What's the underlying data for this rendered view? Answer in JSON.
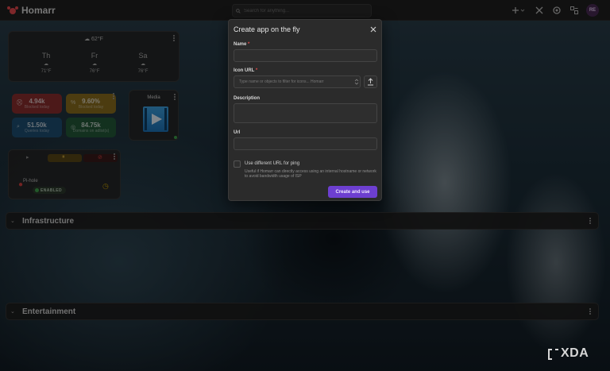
{
  "app": {
    "brand": "Homarr",
    "avatar_initials": "RE"
  },
  "search": {
    "placeholder": "Search for anything..."
  },
  "weather": {
    "current": "62°F",
    "days": [
      {
        "day": "Th",
        "temp": "71°F"
      },
      {
        "day": "Fr",
        "temp": "76°F"
      },
      {
        "day": "Sa",
        "temp": "76°F"
      }
    ]
  },
  "dns_stats": [
    {
      "value": "4.94k",
      "label": "Blocked today",
      "color": "#8a2f2f"
    },
    {
      "value": "9.60%",
      "label": "Blocked today",
      "color": "#8a6d1e"
    },
    {
      "value": "51.50k",
      "label": "Queries today",
      "color": "#1e4f73"
    },
    {
      "value": "84.75k",
      "label": "Domains on adlist(s)",
      "color": "#235a3a"
    }
  ],
  "media": {
    "title": "Media"
  },
  "pihole": {
    "name": "Pi-hole",
    "status": "ENABLED"
  },
  "sections": [
    {
      "title": "Infrastructure"
    },
    {
      "title": "Entertainment"
    }
  ],
  "modal": {
    "title": "Create app on the fly",
    "name_label": "Name",
    "icon_label": "Icon URL",
    "icon_placeholder": "Type name or objects to filter for icons... Homarr",
    "description_label": "Description",
    "url_label": "Url",
    "ping_label": "Use different URL for ping",
    "ping_description": "Useful if Homarr can directly access using an internal hostname or network to avoid bandwidth usage of ISP",
    "submit_label": "Create and use",
    "accent_color": "#6d3fd0"
  },
  "watermark": "XDA"
}
